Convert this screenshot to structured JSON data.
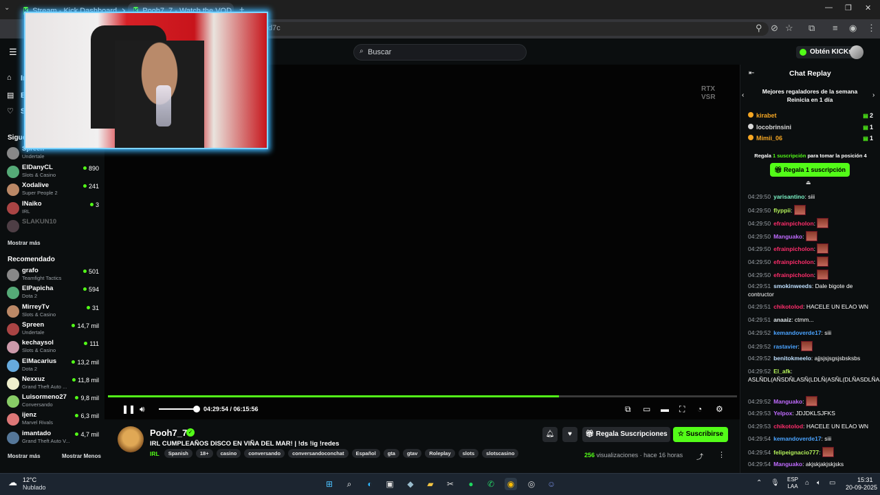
{
  "browser": {
    "tabs": [
      {
        "label": "Stream - Kick Dashboard",
        "active": false
      },
      {
        "label": "Pooh7_7 - Watch the VOD",
        "active": true
      }
    ],
    "url": "d7c"
  },
  "header": {
    "search_placeholder": "Buscar",
    "get_kicks": "Obtén KICKs"
  },
  "sidebar": {
    "nav": [
      {
        "label": "In",
        "icon": "home-icon"
      },
      {
        "label": "E",
        "icon": "browse-icon"
      },
      {
        "label": "S",
        "icon": "heart-icon"
      }
    ],
    "following_title": "Sigue",
    "following": [
      {
        "name": "Spreen",
        "category": "Undertale",
        "viewers": ""
      },
      {
        "name": "ElDanyCL",
        "category": "Slots & Casino",
        "viewers": "890"
      },
      {
        "name": "Xodalive",
        "category": "Super People 2",
        "viewers": "241"
      },
      {
        "name": "INaiko",
        "category": "IRL",
        "viewers": "3"
      },
      {
        "name": "SLAKUN10",
        "category": "",
        "viewers": ""
      }
    ],
    "show_more": "Mostrar más",
    "recommended_title": "Recomendado",
    "recommended": [
      {
        "name": "grafo",
        "category": "Teamfight Tactics",
        "viewers": "501"
      },
      {
        "name": "ElPapicha",
        "category": "Dota 2",
        "viewers": "594"
      },
      {
        "name": "MirreyTv",
        "category": "Slots & Casino",
        "viewers": "31"
      },
      {
        "name": "Spreen",
        "category": "Undertale",
        "viewers": "14,7 mil"
      },
      {
        "name": "kechaysol",
        "category": "Slots & Casino",
        "viewers": "111"
      },
      {
        "name": "ElMacarius",
        "category": "Dota 2",
        "viewers": "13,2 mil"
      },
      {
        "name": "Nexxuz",
        "category": "Grand Theft Auto ...",
        "viewers": "11,8 mil"
      },
      {
        "name": "Luisormeno27",
        "category": "Conversando",
        "viewers": "9,8 mil"
      },
      {
        "name": "ijenz",
        "category": "Marvel Rivals",
        "viewers": "6,3 mil"
      },
      {
        "name": "imantado",
        "category": "Grand Theft Auto V...",
        "viewers": "4,7 mil"
      }
    ],
    "show_more_2": "Mostrar más",
    "show_less": "Mostrar Menos"
  },
  "player": {
    "watermark_1": "RTX",
    "watermark_2": "VSR",
    "time": "04:29:54 / 06:15:56",
    "progress": 0.717,
    "volume": 1.0
  },
  "stream": {
    "streamer": "Pooh7_7",
    "title": "IRL CUMPLEAÑOS DISCO EN VIÑA DEL MAR! | !ds !ig !redes",
    "category": "IRL",
    "tags": [
      "Spanish",
      "18+",
      "casino",
      "conversando",
      "conversandoconchat",
      "Español",
      "gta",
      "gtav",
      "Roleplay",
      "slots",
      "slotscasino"
    ],
    "gift_subs": "Regala Suscripciones",
    "subscribe": "Suscribirse",
    "views_count": "256",
    "views_label": "visualizaciones",
    "ago": "hace 16 horas"
  },
  "chat": {
    "title": "Chat Replay",
    "leader_title": "Mejores regaladores de la semana",
    "leader_sub": "Reinicia en 1 día",
    "leaders": [
      {
        "name": "kirabet",
        "count": "2",
        "color": "#f5a623"
      },
      {
        "name": "locobrinsini",
        "count": "1",
        "color": "#d8d8d8"
      },
      {
        "name": "Mimii_06",
        "count": "1",
        "color": "#f5a623"
      }
    ],
    "gift_hint_pre": "Regala",
    "gift_hint_mid": "1 suscripción",
    "gift_hint_post": "para tomar la posición 4",
    "gift_one": "Regala 1 suscripción",
    "messages": [
      {
        "ts": "04:29:50",
        "user": "yarisantino",
        "color": "#7cf5c8",
        "text": "siii",
        "emote": false
      },
      {
        "ts": "04:29:50",
        "user": "flyppii",
        "color": "#b4f25a",
        "text": "",
        "emote": true
      },
      {
        "ts": "04:29:50",
        "user": "efrainpicholon",
        "color": "#ff2d6b",
        "text": "",
        "emote": true
      },
      {
        "ts": "04:29:50",
        "user": "Manguako",
        "color": "#c06bff",
        "text": "",
        "emote": true
      },
      {
        "ts": "04:29:50",
        "user": "efrainpicholon",
        "color": "#ff2d6b",
        "text": "",
        "emote": true
      },
      {
        "ts": "04:29:50",
        "user": "efrainpicholon",
        "color": "#ff2d6b",
        "text": "",
        "emote": true
      },
      {
        "ts": "04:29:50",
        "user": "efrainpicholon",
        "color": "#ff2d6b",
        "text": "",
        "emote": true
      },
      {
        "ts": "04:29:51",
        "user": "smokinweeds",
        "color": "#bfe0ff",
        "text": "Dale bigote de contructor",
        "emote": false
      },
      {
        "ts": "04:29:51",
        "user": "chikotolod",
        "color": "#ff2d6b",
        "text": "HACELE UN ELAO WN",
        "emote": false
      },
      {
        "ts": "04:29:51",
        "user": "anaaiz",
        "color": "#dfe6ea",
        "text": "ctmm...",
        "emote": false
      },
      {
        "ts": "04:29:52",
        "user": "kemandoverde17",
        "color": "#4aa3ff",
        "text": "siii",
        "emote": false
      },
      {
        "ts": "04:29:52",
        "user": "rastavier",
        "color": "#4aa3ff",
        "text": "",
        "emote": true
      },
      {
        "ts": "04:29:52",
        "user": "benitokmeelo",
        "color": "#bfe0ff",
        "text": "ajjsjsjsgsjsbsksbs",
        "emote": false
      },
      {
        "ts": "04:29:52",
        "user": "El_afk",
        "color": "#b4f25a",
        "text": "ASLÑDL(AÑSDÑLASÑ(LDLÑ(ASÑL(DLÑASDLÑAS",
        "emote": false
      },
      {
        "ts": "04:29:52",
        "user": "Manguako",
        "color": "#c06bff",
        "text": "",
        "emote": true
      },
      {
        "ts": "04:29:53",
        "user": "Yelpox",
        "color": "#c06bff",
        "text": "JDJDKLSJFKS",
        "emote": false
      },
      {
        "ts": "04:29:53",
        "user": "chikotolod",
        "color": "#ff2d6b",
        "text": "HACELE UN ELAO WN",
        "emote": false
      },
      {
        "ts": "04:29:54",
        "user": "kemandoverde17",
        "color": "#4aa3ff",
        "text": "siii",
        "emote": false
      },
      {
        "ts": "04:29:54",
        "user": "felipeignacio777",
        "color": "#b4f25a",
        "text": "",
        "emote": true
      },
      {
        "ts": "04:29:54",
        "user": "Manguako",
        "color": "#c06bff",
        "text": "akjskjakjskjsks",
        "emote": false
      }
    ]
  },
  "taskbar": {
    "temp": "12°C",
    "weather": "Nublado",
    "lang_1": "ESP",
    "lang_2": "LAA",
    "time": "15:31",
    "date": "20-09-2025"
  },
  "colors": {
    "accent": "#53fc18",
    "background": "#0b0e0f"
  }
}
